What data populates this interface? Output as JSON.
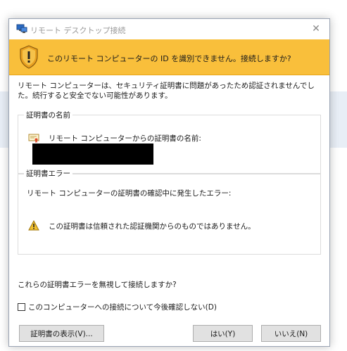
{
  "window": {
    "title": "リモート デスクトップ接続",
    "close_glyph": "✕"
  },
  "banner": {
    "message": "このリモート コンピューターの ID を識別できません。接続しますか?",
    "accent": "#f9bf3b"
  },
  "intro": "リモート コンピューターは、セキュリティ証明書に問題があったため認証されませんでした。続行すると安全でない可能性があります。",
  "certificate_group": {
    "title": "証明書の名前",
    "label": "リモート コンピューターからの証明書の名前:",
    "name_value": ""
  },
  "error_group": {
    "title": "証明書エラー",
    "description": "リモート コンピューターの証明書の確認中に発生したエラー:",
    "error_message": "この証明書は信頼された認証機関からのものではありません。"
  },
  "question": "これらの証明書エラーを無視して接続しますか?",
  "checkbox": {
    "label": "このコンピューターへの接続について今後確認しない(D)",
    "checked": false
  },
  "buttons": {
    "view_certificate": "証明書の表示(V)...",
    "yes": "はい(Y)",
    "no": "いいえ(N)"
  },
  "icons": {
    "app": "remote-desktop-icon",
    "banner": "warning-shield-icon",
    "certificate": "certificate-icon",
    "error": "warning-triangle-icon"
  }
}
